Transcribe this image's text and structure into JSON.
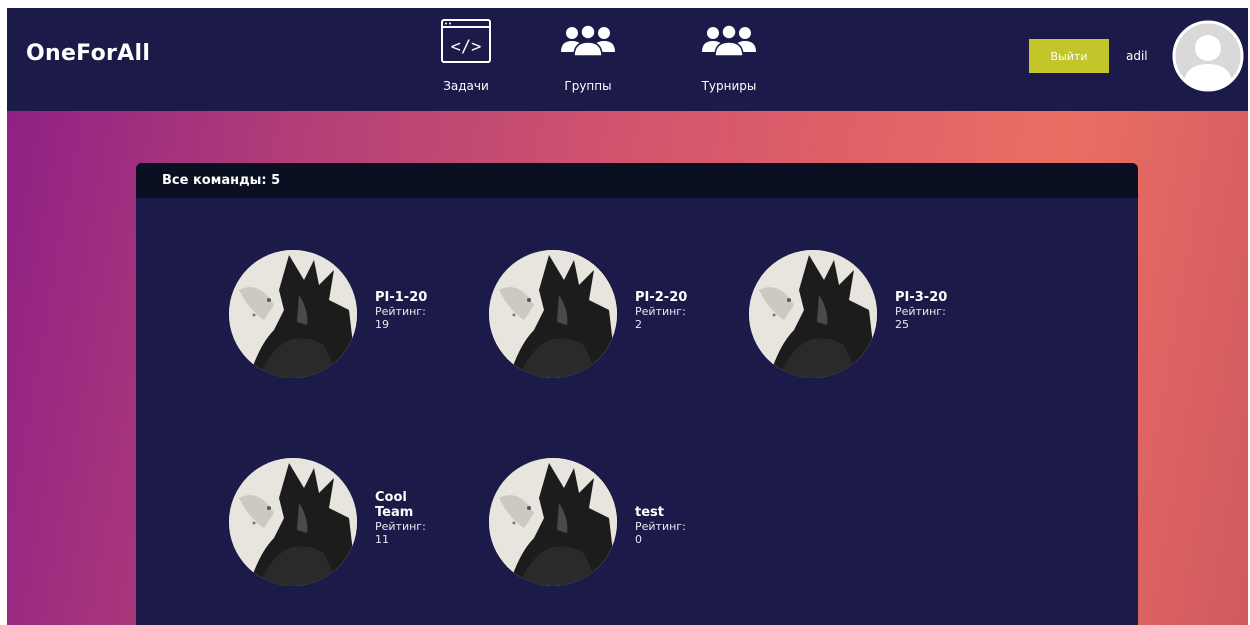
{
  "app": {
    "brand": "OneForAll"
  },
  "nav": {
    "tasks_label": "Задачи",
    "groups_label": "Группы",
    "tournaments_label": "Турниры"
  },
  "user": {
    "logout_label": "Выйти",
    "username": "adil"
  },
  "panel": {
    "title": "Все команды: 5"
  },
  "teams": [
    {
      "name": "PI-1-20",
      "rating_label": "Рейтинг:",
      "rating": "19"
    },
    {
      "name": "PI-2-20",
      "rating_label": "Рейтинг:",
      "rating": "2"
    },
    {
      "name": "PI-3-20",
      "rating_label": "Рейтинг:",
      "rating": "25"
    },
    {
      "name": "Cool Team",
      "rating_label": "Рейтинг:",
      "rating": "11"
    },
    {
      "name": "test",
      "rating_label": "Рейтинг:",
      "rating": "0"
    }
  ],
  "colors": {
    "navbar": "#1b1a48",
    "panel": "#1b1a48",
    "panel_header": "#0b0f22",
    "logout_button": "#c2c62a",
    "gradient_start": "#8e1f86",
    "gradient_end": "#ea6e63"
  },
  "icons": {
    "tasks": "code-window-icon",
    "groups": "group-people-icon",
    "tournaments": "group-people-icon",
    "avatar": "user-avatar-icon",
    "team": "team-avatar-image"
  }
}
